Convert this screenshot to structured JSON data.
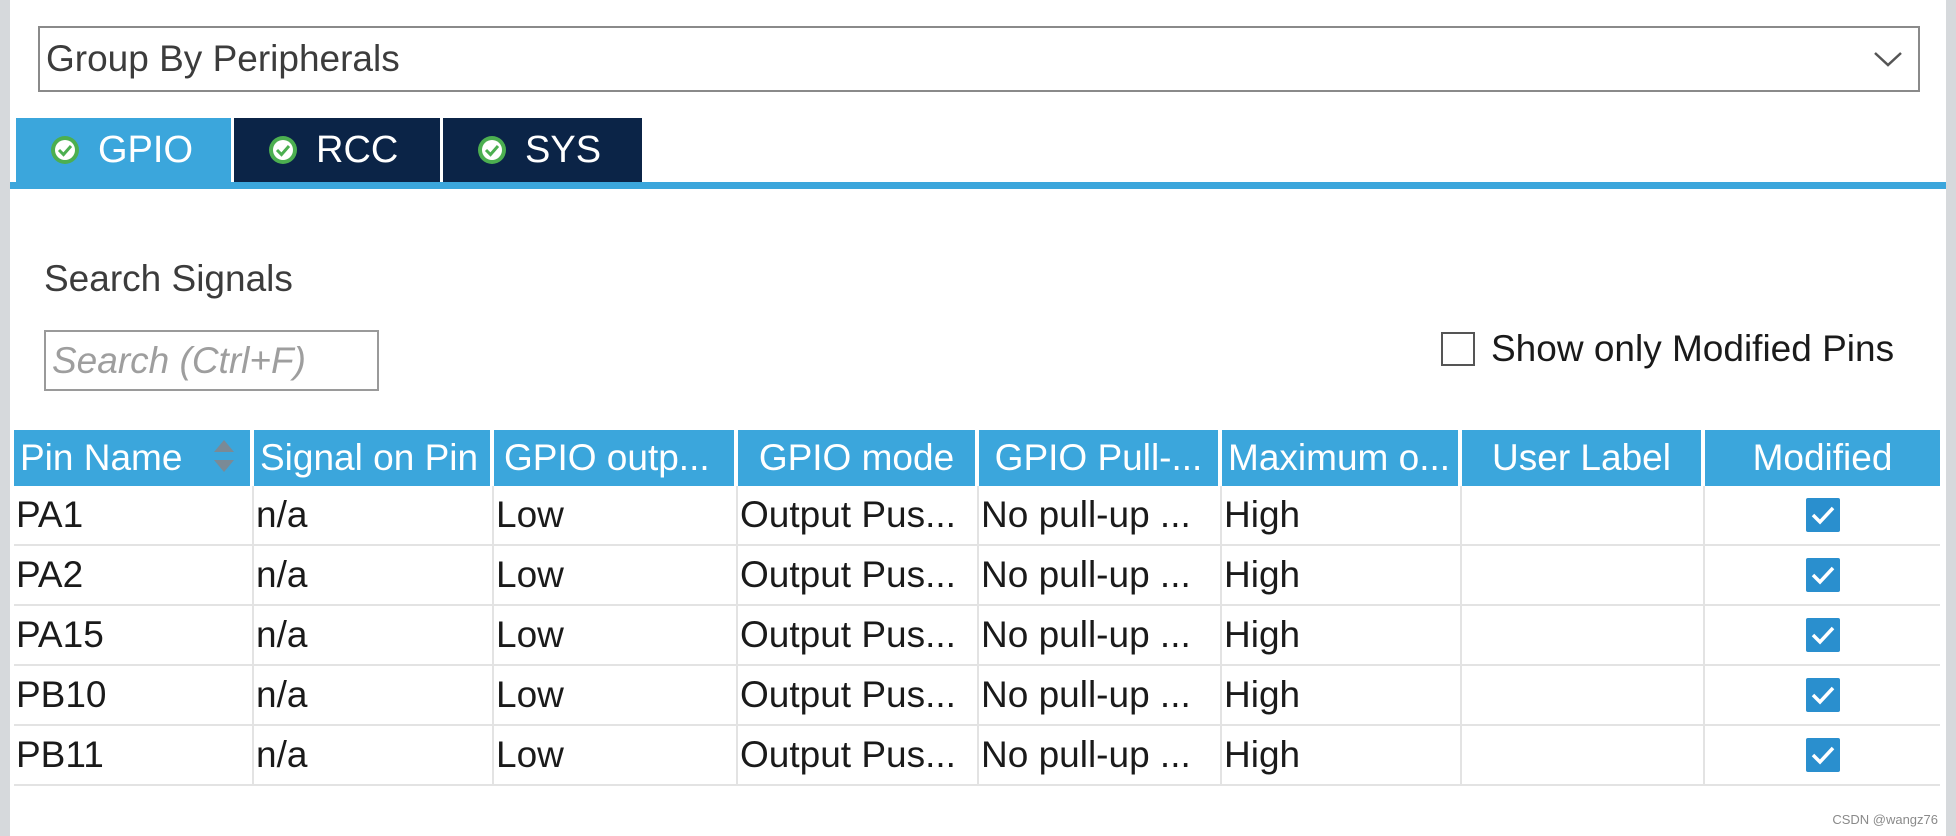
{
  "group_by": {
    "value": "Group By Peripherals"
  },
  "tabs": [
    {
      "label": "GPIO",
      "active": true
    },
    {
      "label": "RCC",
      "active": false
    },
    {
      "label": "SYS",
      "active": false
    }
  ],
  "search": {
    "label": "Search Signals",
    "placeholder": "Search (Ctrl+F)",
    "value": ""
  },
  "show_modified": {
    "label": "Show only Modified Pins",
    "checked": false
  },
  "table": {
    "headers": [
      "Pin Name",
      "Signal on Pin",
      "GPIO outp...",
      "GPIO mode",
      "GPIO Pull-...",
      "Maximum o...",
      "User Label",
      "Modified"
    ],
    "rows": [
      {
        "pin": "PA1",
        "signal": "n/a",
        "output": "Low",
        "mode": "Output Pus...",
        "pull": "No pull-up ...",
        "max": "High",
        "label": "",
        "modified": true
      },
      {
        "pin": "PA2",
        "signal": "n/a",
        "output": "Low",
        "mode": "Output Pus...",
        "pull": "No pull-up ...",
        "max": "High",
        "label": "",
        "modified": true
      },
      {
        "pin": "PA15",
        "signal": "n/a",
        "output": "Low",
        "mode": "Output Pus...",
        "pull": "No pull-up ...",
        "max": "High",
        "label": "",
        "modified": true
      },
      {
        "pin": "PB10",
        "signal": "n/a",
        "output": "Low",
        "mode": "Output Pus...",
        "pull": "No pull-up ...",
        "max": "High",
        "label": "",
        "modified": true
      },
      {
        "pin": "PB11",
        "signal": "n/a",
        "output": "Low",
        "mode": "Output Pus...",
        "pull": "No pull-up ...",
        "max": "High",
        "label": "",
        "modified": true
      }
    ]
  },
  "watermark": "CSDN @wangz76",
  "colors": {
    "accent": "#3ba6dc",
    "tab_inactive": "#0b2447",
    "checkbox": "#2a8fce",
    "tab_check": "#4caf50"
  },
  "icons": {
    "tab_status": "check-circle-icon",
    "dropdown": "chevron-down-icon",
    "sort": "sort-icon",
    "modified": "checkbox-checked-icon"
  }
}
